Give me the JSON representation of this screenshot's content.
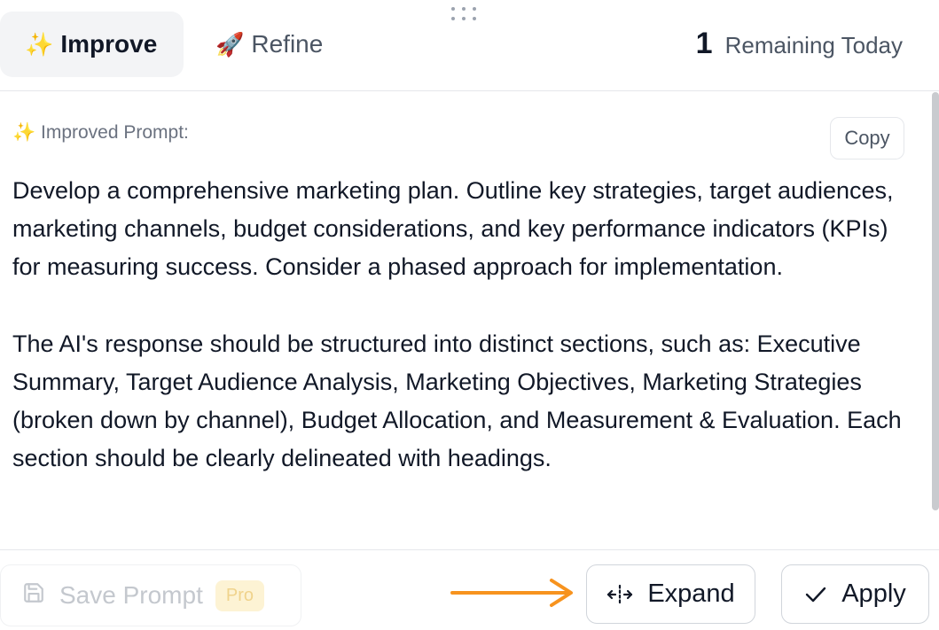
{
  "tabs": [
    {
      "emoji": "✨",
      "label": "Improve"
    },
    {
      "emoji": "🚀",
      "label": "Refine"
    }
  ],
  "remaining": {
    "count": "1",
    "label": "Remaining Today"
  },
  "content": {
    "heading_emoji": "✨",
    "heading": "Improved Prompt:",
    "copy_label": "Copy",
    "paragraphs": [
      "Develop a comprehensive marketing plan. Outline key strategies, target audiences, marketing channels, budget considerations, and key performance indicators (KPIs) for measuring success. Consider a phased approach for implementation.",
      "The AI's response should be structured into distinct sections, such as: Executive Summary, Target Audience Analysis, Marketing Objectives, Marketing Strategies (broken down by channel), Budget Allocation, and Measurement & Evaluation. Each section should be clearly delineated with headings."
    ]
  },
  "footer": {
    "save_label": "Save Prompt",
    "pro_badge": "Pro",
    "expand_label": "Expand",
    "apply_label": "Apply"
  },
  "colors": {
    "arrow": "#f7931e",
    "active_tab_bg": "#f3f4f6",
    "pro_badge_bg": "#fdf3d4"
  },
  "icons": [
    "drag-handle-icon",
    "sparkles-icon",
    "rocket-icon",
    "save-icon",
    "expand-icon",
    "check-icon",
    "arrow-right-icon"
  ]
}
